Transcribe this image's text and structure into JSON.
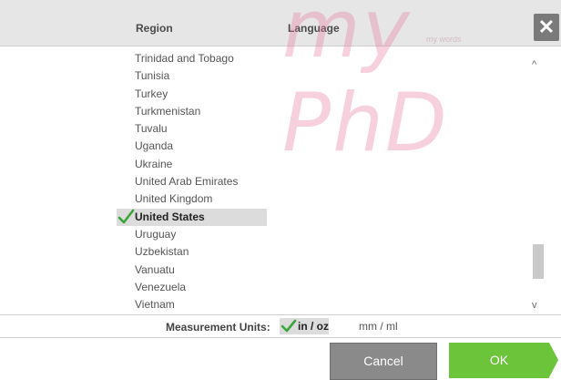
{
  "header": {
    "region_label": "Region",
    "language_label": "Language",
    "close_glyph": "✕"
  },
  "watermark": {
    "main": "my PhD",
    "tag": "my words"
  },
  "regions": {
    "items": [
      {
        "label": "Trinidad and Tobago",
        "selected": false
      },
      {
        "label": "Tunisia",
        "selected": false
      },
      {
        "label": "Turkey",
        "selected": false
      },
      {
        "label": "Turkmenistan",
        "selected": false
      },
      {
        "label": "Tuvalu",
        "selected": false
      },
      {
        "label": "Uganda",
        "selected": false
      },
      {
        "label": "Ukraine",
        "selected": false
      },
      {
        "label": "United Arab Emirates",
        "selected": false
      },
      {
        "label": "United Kingdom",
        "selected": false
      },
      {
        "label": "United States",
        "selected": true
      },
      {
        "label": "Uruguay",
        "selected": false
      },
      {
        "label": "Uzbekistan",
        "selected": false
      },
      {
        "label": "Vanuatu",
        "selected": false
      },
      {
        "label": "Venezuela",
        "selected": false
      },
      {
        "label": "Vietnam",
        "selected": false
      }
    ],
    "check_color": "#3aa63a"
  },
  "scrollbar": {
    "up_glyph": "^",
    "down_glyph": "v"
  },
  "units": {
    "label": "Measurement Units:",
    "options": [
      {
        "label": "in / oz",
        "selected": true
      },
      {
        "label": "mm / ml",
        "selected": false
      }
    ]
  },
  "buttons": {
    "cancel": "Cancel",
    "ok": "OK"
  },
  "colors": {
    "accent_green": "#6cc43b",
    "cancel_gray": "#8a8a8a",
    "header_bg": "#e6e6e6"
  }
}
